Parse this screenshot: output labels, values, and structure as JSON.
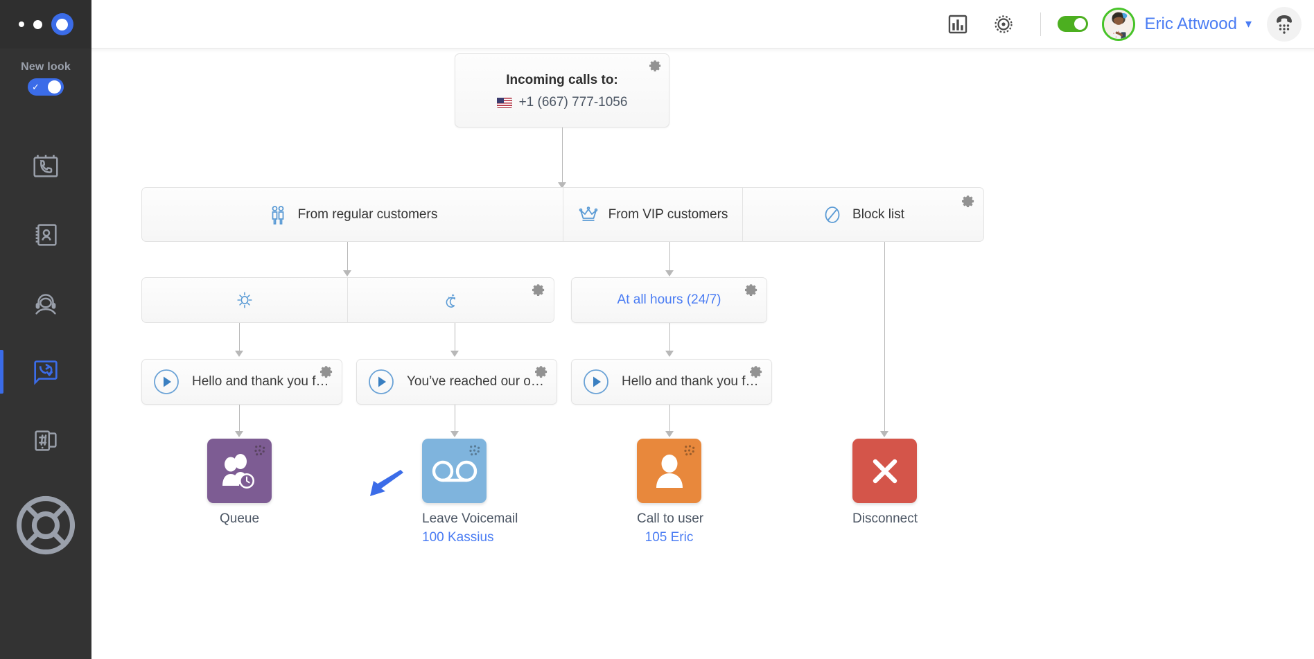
{
  "sidebar": {
    "brand_dots": [
      "dot-small",
      "dot-medium",
      "dot-ring"
    ],
    "new_look": {
      "label": "New look",
      "enabled": true,
      "toggle_color": "#3b6ce8"
    },
    "items": [
      {
        "name": "call-history",
        "icon": "calendar-phone-icon",
        "active": false
      },
      {
        "name": "contacts",
        "icon": "address-book-icon",
        "active": false
      },
      {
        "name": "agents",
        "icon": "headset-agent-icon",
        "active": false
      },
      {
        "name": "call-flows",
        "icon": "call-flow-icon",
        "active": true
      },
      {
        "name": "numbers",
        "icon": "hash-devices-icon",
        "active": false
      }
    ],
    "help": {
      "name": "help",
      "icon": "lifebuoy-icon"
    }
  },
  "header": {
    "stats_icon": "bar-chart-icon",
    "settings_icon": "gear-target-icon",
    "status_toggle": {
      "enabled": true,
      "color": "#4caf20"
    },
    "user_name": "Eric Attwood",
    "user_caret": "chevron-down-icon",
    "avatar_alt": "user-avatar",
    "dialpad_icon": "dialpad-handset-icon",
    "link_color": "#4a7cf3"
  },
  "flow": {
    "root": {
      "title": "Incoming calls to:",
      "number": "+1 (667) 777-1056",
      "flag": "us-flag",
      "gear": "gear-icon"
    },
    "segments_row": {
      "gear": "gear-icon",
      "items": [
        {
          "label": "From regular customers",
          "icon": "two-people-icon"
        },
        {
          "label": "From VIP customers",
          "icon": "crown-icon"
        },
        {
          "label": "Block list",
          "icon": "block-circle-icon"
        }
      ]
    },
    "schedule_left": {
      "gear": "gear-icon",
      "items": [
        {
          "label": "",
          "icon": "sun-icon"
        },
        {
          "label": "",
          "icon": "moon-icon"
        }
      ]
    },
    "schedule_right": {
      "gear": "gear-icon",
      "label": "At all hours (24/7)"
    },
    "greetings": [
      {
        "text": "Hello and thank you f…",
        "icon": "play-icon",
        "gear": "gear-icon"
      },
      {
        "text": "You’ve reached our o…",
        "icon": "play-icon",
        "gear": "gear-icon"
      },
      {
        "text": "Hello and thank you f…",
        "icon": "play-icon",
        "gear": "gear-icon"
      }
    ],
    "actions": [
      {
        "label": "Queue",
        "sub": "",
        "icon": "queue-people-clock-icon",
        "color": "#7d5c93"
      },
      {
        "label": "Leave Voicemail",
        "sub": "100 Kassius",
        "icon": "voicemail-icon",
        "color": "#7fb4dd"
      },
      {
        "label": "Call to user",
        "sub": "105 Eric",
        "icon": "person-icon",
        "color": "#e8883c"
      },
      {
        "label": "Disconnect",
        "sub": "",
        "icon": "close-x-icon",
        "color": "#d4554a"
      }
    ],
    "annotation_arrow": {
      "name": "pointer-arrow",
      "color": "#3b6ce8"
    }
  }
}
